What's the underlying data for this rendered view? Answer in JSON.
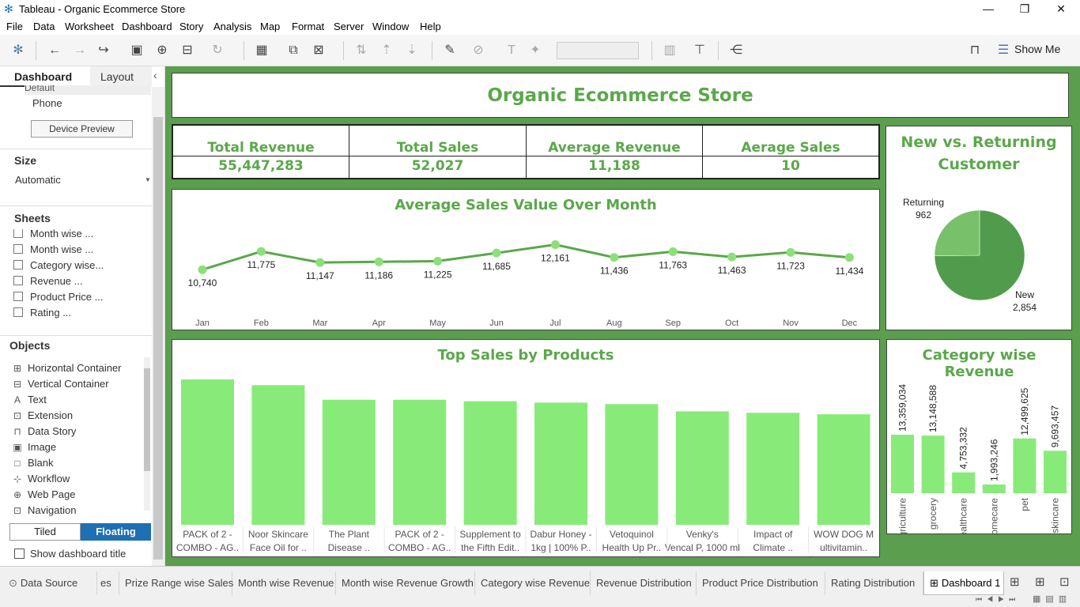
{
  "window": {
    "title": "Tableau - Organic Ecommerce Store",
    "app_icon": "tableau-logo-icon"
  },
  "menu": [
    "File",
    "Data",
    "Worksheet",
    "Dashboard",
    "Story",
    "Analysis",
    "Map",
    "Format",
    "Server",
    "Window",
    "Help"
  ],
  "toolbar": {
    "show_me": "Show Me"
  },
  "left_pane": {
    "tabs": [
      "Dashboard",
      "Layout"
    ],
    "device": {
      "partial": "Default",
      "phone": "Phone",
      "preview_button": "Device Preview"
    },
    "size": {
      "title": "Size",
      "value": "Automatic"
    },
    "sheets": {
      "title": "Sheets",
      "items": [
        "Month wise ...",
        "Month wise ...",
        "Category wise...",
        "Revenue ...",
        "Product Price ...",
        "Rating ..."
      ]
    },
    "objects": {
      "title": "Objects",
      "items": [
        "Horizontal Container",
        "Vertical Container",
        "Text",
        "Extension",
        "Data Story",
        "Image",
        "Blank",
        "Workflow",
        "Web Page",
        "Navigation"
      ]
    },
    "placement": {
      "tiled": "Tiled",
      "floating": "Floating"
    },
    "show_title": "Show dashboard title"
  },
  "dashboard": {
    "title": "Organic Ecommerce Store",
    "kpis": [
      {
        "label": "Total Revenue",
        "value": "55,447,283"
      },
      {
        "label": "Total Sales",
        "value": "52,027"
      },
      {
        "label": "Average Revenue",
        "value": "11,188"
      },
      {
        "label": "Aerage Sales",
        "value": "10"
      }
    ]
  },
  "chart_data": [
    {
      "type": "line",
      "title": "Average Sales Value Over Month",
      "categories": [
        "Jan",
        "Feb",
        "Mar",
        "Apr",
        "May",
        "Jun",
        "Jul",
        "Aug",
        "Sep",
        "Oct",
        "Nov",
        "Dec"
      ],
      "values": [
        10740,
        11775,
        11147,
        11186,
        11225,
        11685,
        12161,
        11436,
        11763,
        11463,
        11723,
        11434
      ],
      "labels": [
        "10,740",
        "11,775",
        "11,147",
        "11,186",
        "11,225",
        "11,685",
        "12,161",
        "11,436",
        "11,763",
        "11,463",
        "11,723",
        "11,434"
      ],
      "ylim": [
        9000,
        12500
      ],
      "color": "#5aa84a",
      "grid": false
    },
    {
      "type": "pie",
      "title": "New vs. Returning Customer",
      "slices": [
        {
          "name": "New",
          "value": 2854,
          "label": "2,854",
          "color": "#519c4c"
        },
        {
          "name": "Returning",
          "value": 962,
          "label": "962",
          "color": "#79c06b"
        }
      ]
    },
    {
      "type": "bar",
      "title": "Top Sales by Products",
      "categories": [
        "PACK of 2 - COMBO - AG..",
        "Noor Skincare Face Oil for ..",
        "The Plant Disease ..",
        "PACK of 2 - COMBO - AG..",
        "Supplement to the Fifth Edit..",
        "Dabur Honey - 1kg | 100% P..",
        "Vetoquinol Health Up Pr..",
        "Venky's Vencal P, 1000 ml",
        "Impact of Climate ..",
        "WOW DOG M ultivitamin.."
      ],
      "values": [
        100,
        96,
        86,
        86,
        85,
        84,
        83,
        78,
        77,
        76
      ],
      "color": "#88eb79"
    },
    {
      "type": "bar",
      "title": "Category wise Revenue",
      "categories": [
        "agriculture",
        "grocery",
        "healthcare",
        "homecare",
        "pet",
        "skincare"
      ],
      "values": [
        13359034,
        13148588,
        4753332,
        1993246,
        12499625,
        9693457
      ],
      "labels": [
        "13,359,034",
        "13,148,588",
        "4,753,332",
        "1,993,246",
        "12,499,625",
        "9,693,457"
      ],
      "color": "#88eb79"
    }
  ],
  "bottom_tabs": [
    "Data Source",
    "es",
    "Prize Range wise Sales",
    "Month wise Revenue",
    "Month wise Revenue Growth",
    "Category wise Revenue",
    "Revenue Distribution",
    "Product Price Distribution",
    "Rating Distribution",
    "Dashboard 1"
  ]
}
